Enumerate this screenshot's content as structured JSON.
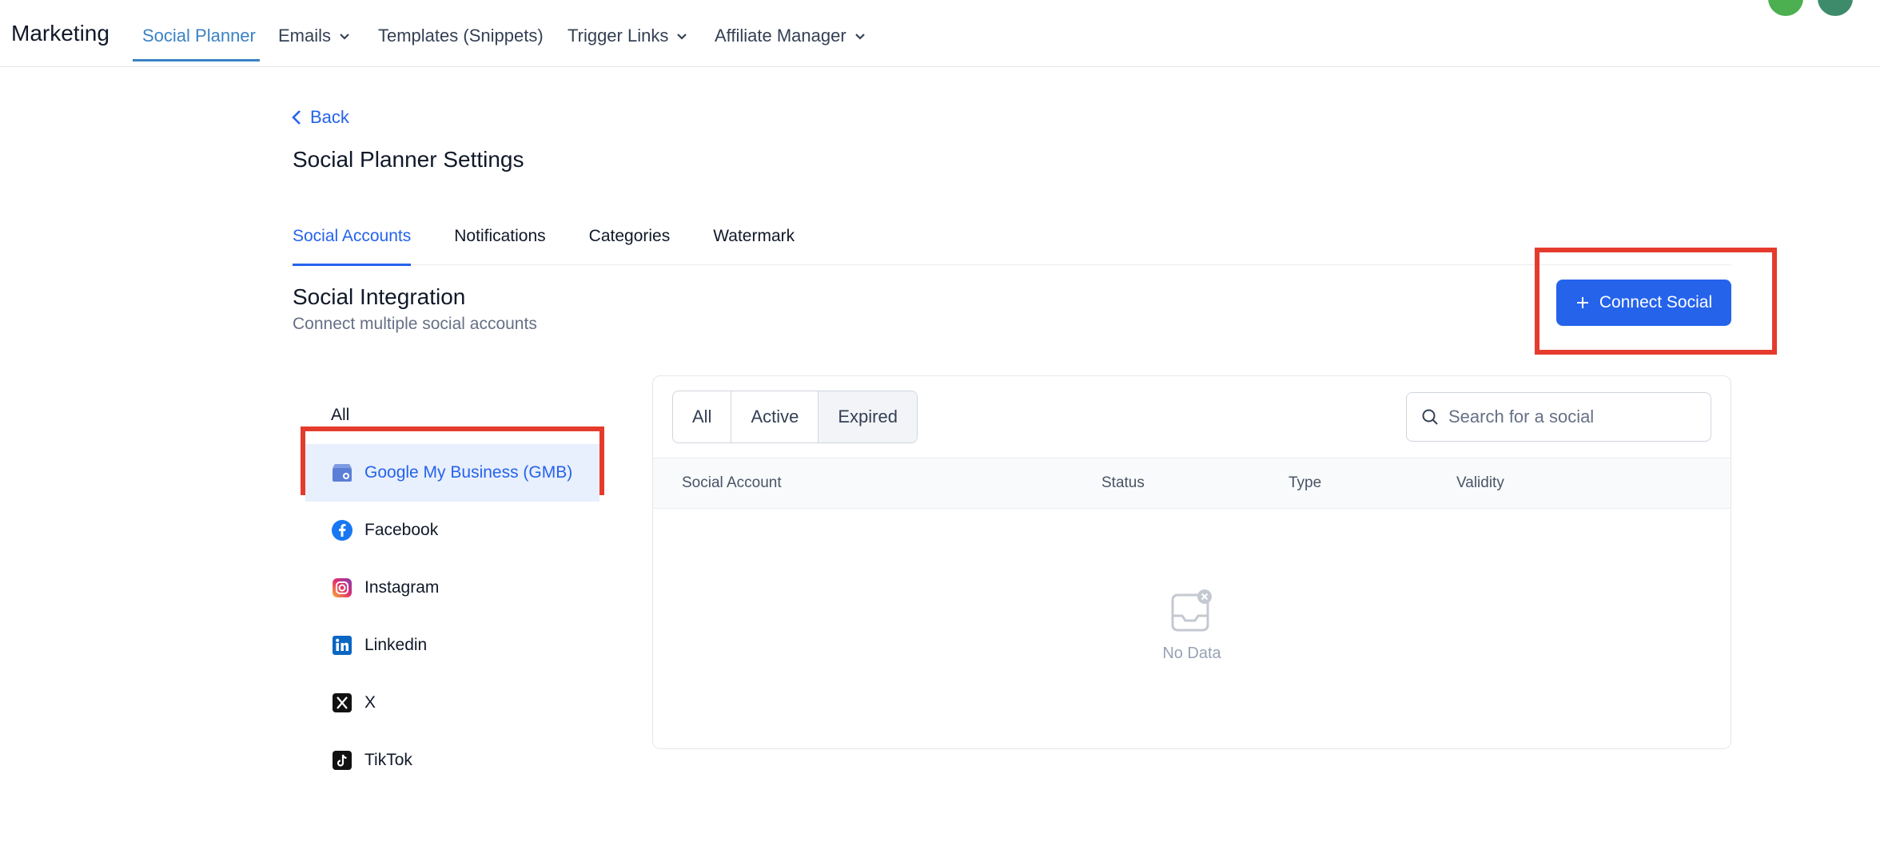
{
  "nav": {
    "brand": "Marketing",
    "items": [
      {
        "label": "Social Planner"
      },
      {
        "label": "Emails"
      },
      {
        "label": "Templates (Snippets)"
      },
      {
        "label": "Trigger Links"
      },
      {
        "label": "Affiliate Manager"
      }
    ]
  },
  "back_label": "Back",
  "page_title": "Social Planner Settings",
  "tabs": [
    {
      "label": "Social Accounts"
    },
    {
      "label": "Notifications"
    },
    {
      "label": "Categories"
    },
    {
      "label": "Watermark"
    }
  ],
  "section": {
    "title": "Social Integration",
    "subtitle": "Connect multiple social accounts"
  },
  "connect_button": {
    "label": "Connect Social"
  },
  "social_list": [
    {
      "label": "All",
      "icon": ""
    },
    {
      "label": "Google My Business (GMB)",
      "icon": "gmb-icon"
    },
    {
      "label": "Facebook",
      "icon": "facebook-icon"
    },
    {
      "label": "Instagram",
      "icon": "instagram-icon"
    },
    {
      "label": "Linkedin",
      "icon": "linkedin-icon"
    },
    {
      "label": "X",
      "icon": "x-icon"
    },
    {
      "label": "TikTok",
      "icon": "tiktok-icon"
    }
  ],
  "filter": {
    "options": [
      {
        "label": "All"
      },
      {
        "label": "Active"
      },
      {
        "label": "Expired"
      }
    ]
  },
  "search": {
    "placeholder": "Search for a social"
  },
  "table": {
    "columns": [
      "Social Account",
      "Status",
      "Type",
      "Validity"
    ],
    "empty_text": "No Data"
  },
  "colors": {
    "primary": "#2563eb",
    "nav_active": "#3b82c4",
    "highlight_box": "#e53b2c"
  }
}
